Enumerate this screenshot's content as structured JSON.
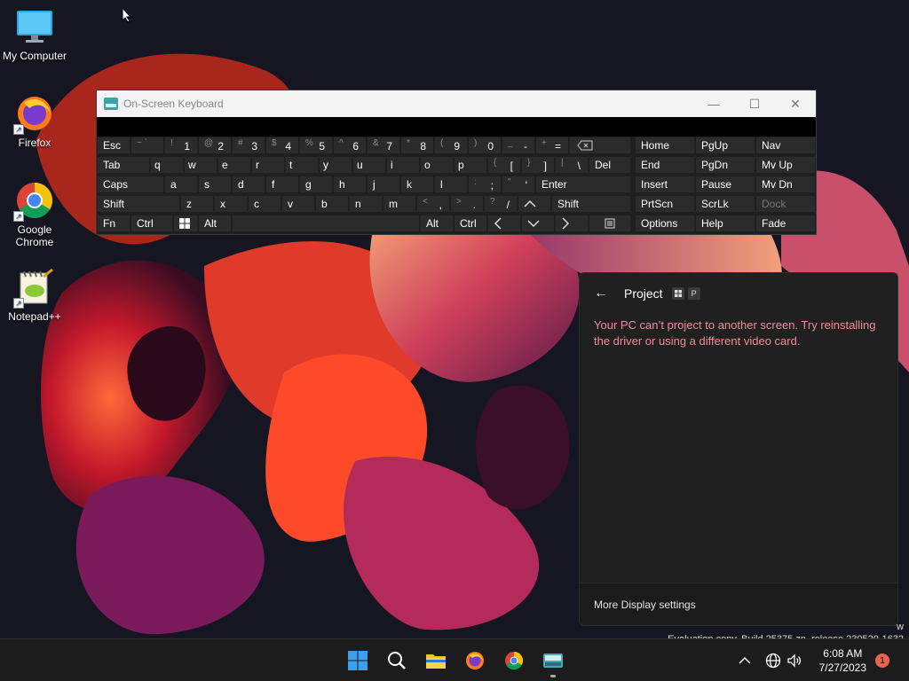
{
  "desktop": {
    "icons": [
      {
        "label": "My Computer",
        "icon": "monitor-icon"
      },
      {
        "label": "Firefox",
        "icon": "firefox-icon"
      },
      {
        "label": "Google Chrome",
        "icon": "chrome-icon"
      },
      {
        "label": "Notepad++",
        "icon": "notepadpp-icon"
      }
    ]
  },
  "osk": {
    "title": "On-Screen Keyboard",
    "row1": {
      "esc": "Esc",
      "tilde_sub": "~ `",
      "k1_sub": "!",
      "k1": "1",
      "k2_sub": "@",
      "k2": "2",
      "k3_sub": "#",
      "k3": "3",
      "k4_sub": "$",
      "k4": "4",
      "k5_sub": "%",
      "k5": "5",
      "k6_sub": "^",
      "k6": "6",
      "k7_sub": "&",
      "k7": "7",
      "k8_sub": "*",
      "k8": "8",
      "k9_sub": "(",
      "k9": "9",
      "k0_sub": ")",
      "k0": "0",
      "minus_sub": "_",
      "minus": "-",
      "plus_sub": "+",
      "plus": "="
    },
    "row2": {
      "tab": "Tab",
      "q": "q",
      "w": "w",
      "e": "e",
      "r": "r",
      "t": "t",
      "y": "y",
      "u": "u",
      "i": "i",
      "o": "o",
      "p": "p",
      "lb_sub": "{",
      "lb": "[",
      "rb_sub": "}",
      "rb": "]",
      "bs_sub": "|",
      "bs": "\\",
      "del": "Del"
    },
    "row3": {
      "caps": "Caps",
      "a": "a",
      "s": "s",
      "d": "d",
      "f": "f",
      "g": "g",
      "h": "h",
      "j": "j",
      "k": "k",
      "l": "l",
      "semi_sub": ":",
      "semi": ";",
      "quote_sub": "\"",
      "quote": "'",
      "enter": "Enter"
    },
    "row4": {
      "shift": "Shift",
      "z": "z",
      "x": "x",
      "c": "c",
      "v": "v",
      "b": "b",
      "n": "n",
      "m": "m",
      "comma_sub": "<",
      "comma": ",",
      "period_sub": ">",
      "period": ".",
      "slash_sub": "?",
      "slash": "/",
      "shift_r": "Shift"
    },
    "row5": {
      "fn": "Fn",
      "ctrl": "Ctrl",
      "alt": "Alt",
      "alt_r": "Alt",
      "ctrl_r": "Ctrl"
    },
    "nav": {
      "home": "Home",
      "pgup": "PgUp",
      "nav": "Nav",
      "end": "End",
      "pgdn": "PgDn",
      "mvup": "Mv Up",
      "insert": "Insert",
      "pause": "Pause",
      "mvdn": "Mv Dn",
      "prtscn": "PrtScn",
      "scrlk": "ScrLk",
      "dock": "Dock",
      "options": "Options",
      "help": "Help",
      "fade": "Fade"
    }
  },
  "project": {
    "title": "Project",
    "shortcut_key": "P",
    "message": "Your PC can’t project to another screen. Try reinstalling the driver or using a different video card.",
    "footer_link": "More Display settings"
  },
  "watermark": {
    "line1": "w",
    "line2": "Evaluation copy. Build 25375.zn_release.230520-1632"
  },
  "taskbar": {
    "time": "6:08 AM",
    "date": "7/27/2023",
    "notification_count": "1"
  },
  "colors": {
    "error_text": "#f08c96",
    "taskbar_bg": "#1c1c1c",
    "notification_badge": "#e8644e"
  }
}
